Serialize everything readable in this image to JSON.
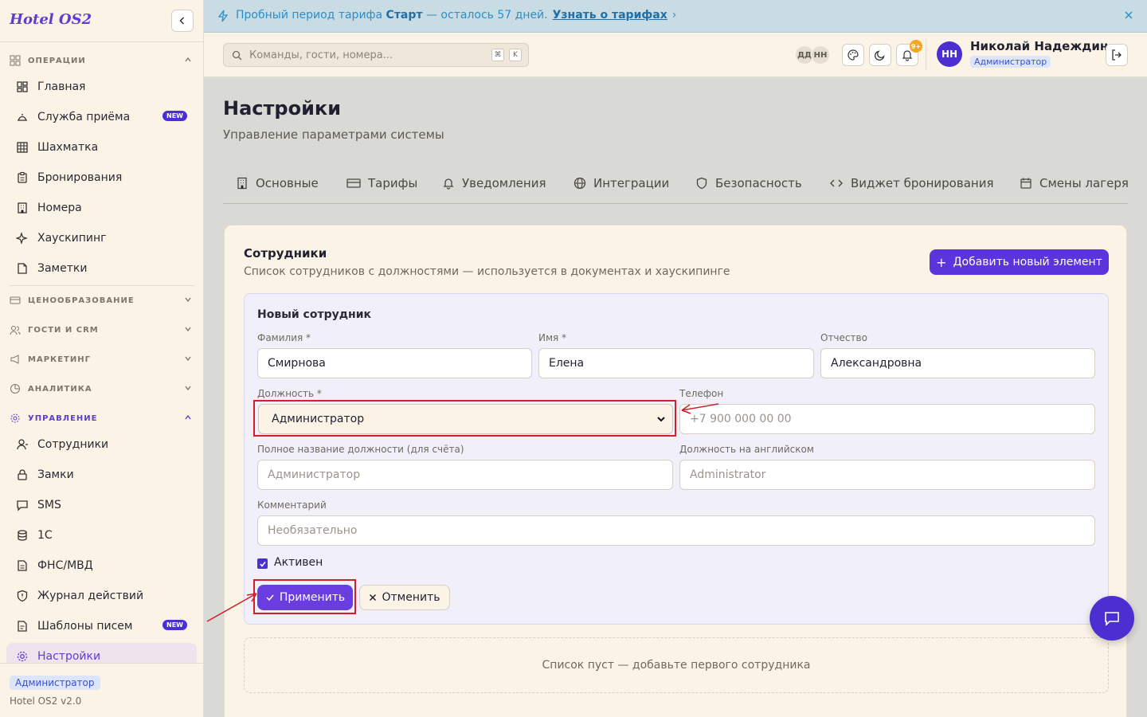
{
  "sidebar": {
    "brand": "Hotel OS2",
    "groups": {
      "operations": "ОПЕРАЦИИ",
      "pricing": "ЦЕНООБРАЗОВАНИЕ",
      "guests": "ГОСТИ И CRM",
      "marketing": "МАРКЕТИНГ",
      "analytics": "АНАЛИТИКА",
      "management": "УПРАВЛЕНИЕ"
    },
    "ops_items": [
      "Главная",
      "Служба приёма",
      "Шахматка",
      "Бронирования",
      "Номера",
      "Хаускипинг",
      "Заметки"
    ],
    "mgmt_items": [
      "Сотрудники",
      "Замки",
      "SMS",
      "1С",
      "ФНС/МВД",
      "Журнал действий",
      "Шаблоны писем",
      "Настройки"
    ],
    "new_badge": "NEW",
    "footer_role": "Администратор",
    "version": "Hotel OS2 v2.0"
  },
  "banner": {
    "text_before": "Пробный период тарифа ",
    "plan": "Старт",
    "text_after": " — осталось 57 дней.",
    "link": "Узнать о тарифах"
  },
  "header": {
    "search_placeholder": "Команды, гости, номера...",
    "kbd1": "⌘",
    "kbd2": "K",
    "mini_avatars": [
      "ДД",
      "НН"
    ],
    "notif_count": "9+",
    "user_initials": "НН",
    "user_name": "Николай Надеждин",
    "user_role": "Администратор"
  },
  "page": {
    "title": "Настройки",
    "subtitle": "Управление параметрами системы",
    "tabs": [
      "Основные",
      "Тарифы",
      "Уведомления",
      "Интеграции",
      "Безопасность",
      "Виджет бронирования",
      "Смены лагеря"
    ]
  },
  "card": {
    "title": "Сотрудники",
    "subtitle": "Список сотрудников с должностями — используется в документах и хаускипинге",
    "add_button": "Добавить новый элемент",
    "empty": "Список пуст — добавьте первого сотрудника"
  },
  "form": {
    "title": "Новый сотрудник",
    "last_name_label": "Фамилия *",
    "last_name": "Смирнова",
    "first_name_label": "Имя *",
    "first_name": "Елена",
    "patronymic_label": "Отчество",
    "patronymic": "Александровна",
    "position_label": "Должность *",
    "position": "Администратор",
    "phone_label": "Телефон",
    "phone_placeholder": "+7 900 000 00 00",
    "full_position_label": "Полное название должности (для счёта)",
    "full_position_placeholder": "Администратор",
    "position_en_label": "Должность на английском",
    "position_en_placeholder": "Administrator",
    "comment_label": "Комментарий",
    "comment_placeholder": "Необязательно",
    "active_label": "Активен",
    "active": true,
    "apply": "Применить",
    "cancel": "Отменить"
  },
  "colors": {
    "accent": "#5b34dc",
    "banner_bg": "#c9dce4",
    "sidebar_bg": "#fbf3e6",
    "highlight": "#d0202a"
  }
}
